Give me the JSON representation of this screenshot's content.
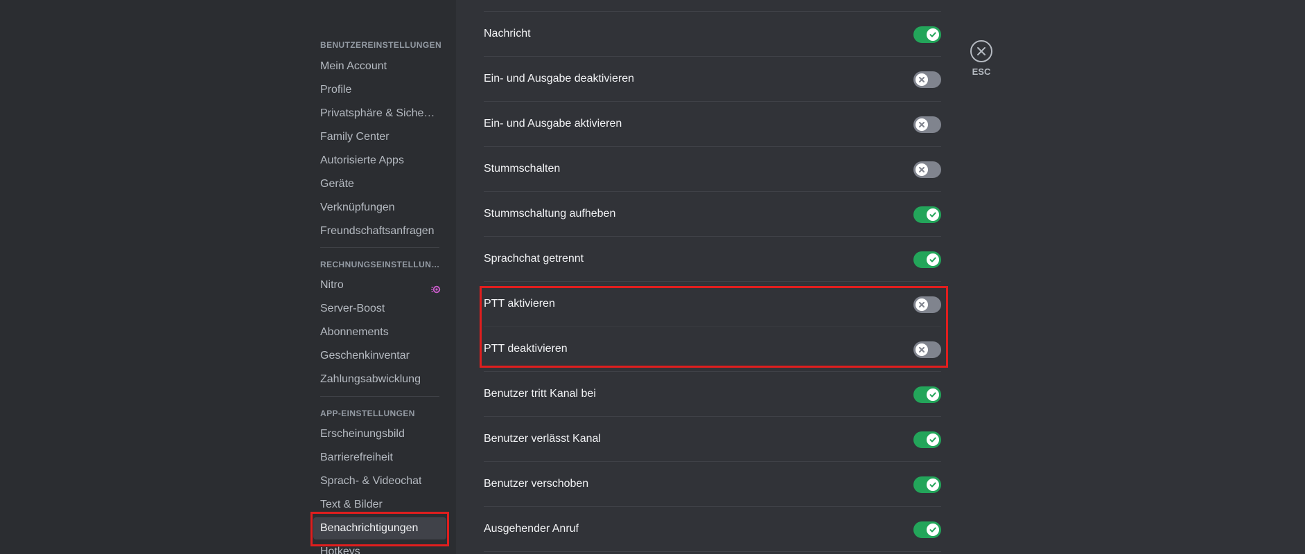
{
  "colors": {
    "toggle_on": "#23a55a",
    "toggle_off": "#80848e",
    "highlight": "#e01e1e",
    "nitro_accent": "#c45ac4"
  },
  "sidebar": {
    "sections": [
      {
        "header": "Benutzereinstellungen",
        "items": [
          {
            "label": "Mein Account"
          },
          {
            "label": "Profile"
          },
          {
            "label": "Privatsphäre & Sicherh..."
          },
          {
            "label": "Family Center"
          },
          {
            "label": "Autorisierte Apps"
          },
          {
            "label": "Geräte"
          },
          {
            "label": "Verknüpfungen"
          },
          {
            "label": "Freundschaftsanfragen"
          }
        ]
      },
      {
        "header": "Rechnungseinstellung...",
        "items": [
          {
            "label": "Nitro",
            "icon": "nitro-icon"
          },
          {
            "label": "Server-Boost"
          },
          {
            "label": "Abonnements"
          },
          {
            "label": "Geschenkinventar"
          },
          {
            "label": "Zahlungsabwicklung"
          }
        ]
      },
      {
        "header": "App-Einstellungen",
        "items": [
          {
            "label": "Erscheinungsbild"
          },
          {
            "label": "Barrierefreiheit"
          },
          {
            "label": "Sprach- & Videochat"
          },
          {
            "label": "Text & Bilder"
          },
          {
            "label": "Benachrichtigungen",
            "selected": true
          },
          {
            "label": "Hotkeys"
          }
        ]
      }
    ]
  },
  "sounds": [
    {
      "label": "Nachricht",
      "enabled": true
    },
    {
      "label": "Ein- und Ausgabe deaktivieren",
      "enabled": false
    },
    {
      "label": "Ein- und Ausgabe aktivieren",
      "enabled": false
    },
    {
      "label": "Stummschalten",
      "enabled": false
    },
    {
      "label": "Stummschaltung aufheben",
      "enabled": true
    },
    {
      "label": "Sprachchat getrennt",
      "enabled": true
    },
    {
      "label": "PTT aktivieren",
      "enabled": false
    },
    {
      "label": "PTT deaktivieren",
      "enabled": false
    },
    {
      "label": "Benutzer tritt Kanal bei",
      "enabled": true
    },
    {
      "label": "Benutzer verlässt Kanal",
      "enabled": true
    },
    {
      "label": "Benutzer verschoben",
      "enabled": true
    },
    {
      "label": "Ausgehender Anruf",
      "enabled": true
    }
  ],
  "close": {
    "label": "ESC",
    "icon": "close-icon"
  }
}
